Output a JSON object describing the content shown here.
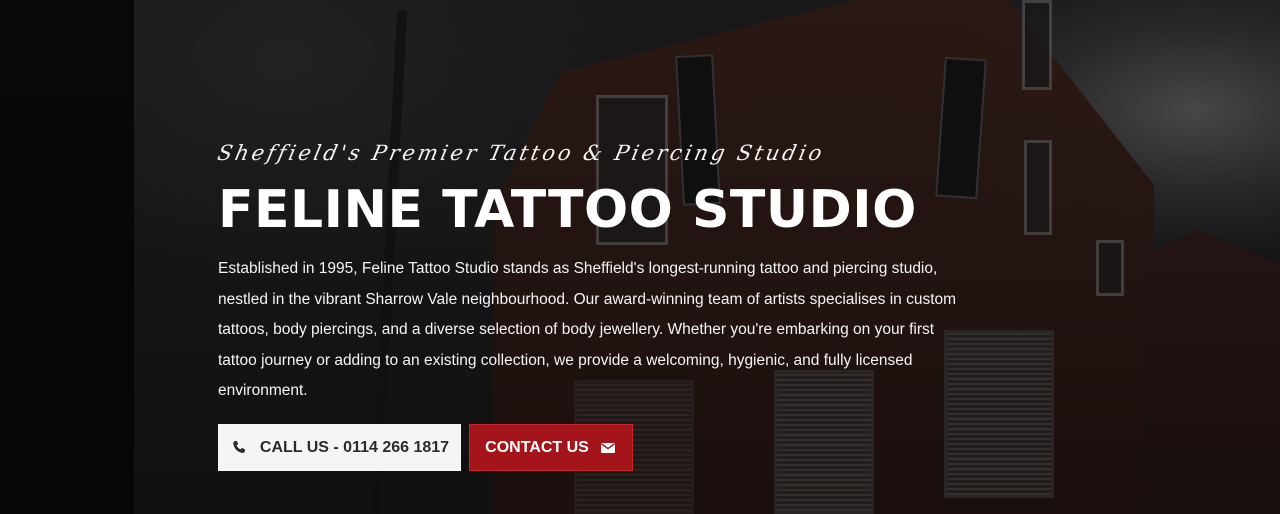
{
  "hero": {
    "tagline": "Sheffield's Premier Tattoo & Piercing Studio",
    "title": "FELINE TATTOO STUDIO",
    "description": "Established in 1995, Feline Tattoo Studio stands as Sheffield's longest-running tattoo and piercing studio, nestled in the vibrant Sharrow Vale neighbourhood. Our award-winning team of artists specialises in custom tattoos, body piercings, and a diverse selection of body jewellery. Whether you're embarking on your first tattoo journey or adding to an existing collection, we provide a welcoming, hygienic, and fully licensed environment."
  },
  "buttons": {
    "call": {
      "label": "CALL US - 0114 266 1817",
      "icon": "phone-icon"
    },
    "contact": {
      "label": "CONTACT US",
      "icon": "envelope-icon"
    }
  },
  "colors": {
    "accent_red": "#a3151a",
    "call_button_bg": "#f5f5f3",
    "text_white": "#ffffff"
  }
}
